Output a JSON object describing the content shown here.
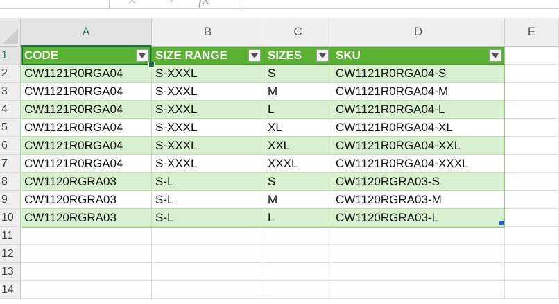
{
  "formula_bar": {
    "cancel_glyph": "✕",
    "enter_glyph": "✓",
    "fx_label": "fx",
    "formula_value": ""
  },
  "columns": [
    "A",
    "B",
    "C",
    "D",
    "E"
  ],
  "rows": [
    "1",
    "2",
    "3",
    "4",
    "5",
    "6",
    "7",
    "8",
    "9",
    "10",
    "11",
    "12",
    "13",
    "14"
  ],
  "table": {
    "headers": [
      "CODE",
      "SIZE RANGE",
      "SIZES",
      "SKU"
    ],
    "data": [
      [
        "CW1121R0RGA04",
        "S-XXXL",
        "S",
        "CW1121R0RGA04-S"
      ],
      [
        "CW1121R0RGA04",
        "S-XXXL",
        "M",
        "CW1121R0RGA04-M"
      ],
      [
        "CW1121R0RGA04",
        "S-XXXL",
        "L",
        "CW1121R0RGA04-L"
      ],
      [
        "CW1121R0RGA04",
        "S-XXXL",
        "XL",
        "CW1121R0RGA04-XL"
      ],
      [
        "CW1121R0RGA04",
        "S-XXXL",
        "XXL",
        "CW1121R0RGA04-XXL"
      ],
      [
        "CW1121R0RGA04",
        "S-XXXL",
        "XXXL",
        "CW1121R0RGA04-XXXL"
      ],
      [
        "CW1120RGRA03",
        "S-L",
        "S",
        "CW1120RGRA03-S"
      ],
      [
        "CW1120RGRA03",
        "S-L",
        "M",
        "CW1120RGRA03-M"
      ],
      [
        "CW1120RGRA03",
        "S-L",
        "L",
        "CW1120RGRA03-L"
      ]
    ]
  },
  "colors": {
    "header_fill": "#5ab033",
    "band_fill": "#d8f0cf",
    "selection": "#1f6b37"
  },
  "icons": {
    "filter": "filter-dropdown-icon",
    "cancel": "cancel-icon",
    "enter": "check-icon",
    "function": "fx-icon"
  }
}
